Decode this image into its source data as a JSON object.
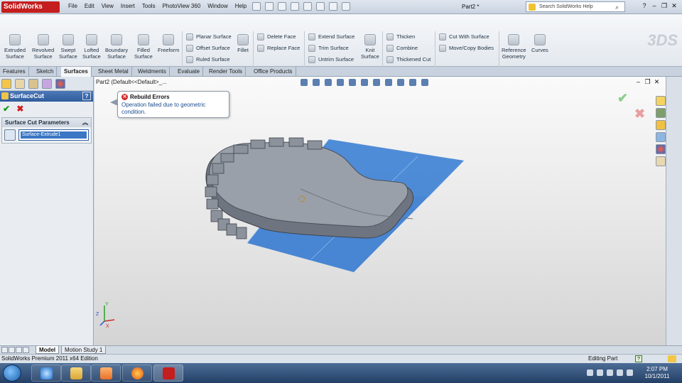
{
  "app": {
    "logo_text": "SolidWorks",
    "document_title": "Part2 *",
    "menu": [
      "File",
      "Edit",
      "View",
      "Insert",
      "Tools",
      "PhotoView 360",
      "Window",
      "Help"
    ],
    "help_search_placeholder": "Search SolidWorks Help"
  },
  "ribbon": {
    "large_tools": [
      {
        "label1": "Extruded",
        "label2": "Surface",
        "icon": "extruded-surface-icon"
      },
      {
        "label1": "Revolved",
        "label2": "Surface",
        "icon": "revolved-surface-icon"
      },
      {
        "label1": "Swept",
        "label2": "Surface",
        "icon": "swept-surface-icon"
      },
      {
        "label1": "Lofted",
        "label2": "Surface",
        "icon": "lofted-surface-icon"
      },
      {
        "label1": "Boundary",
        "label2": "Surface",
        "icon": "boundary-surface-icon"
      },
      {
        "label1": "Filled",
        "label2": "Surface",
        "icon": "filled-surface-icon"
      },
      {
        "label1": "Freeform",
        "label2": "",
        "icon": "freeform-icon"
      }
    ],
    "col1": [
      "Planar Surface",
      "Offset Surface",
      "Ruled Surface"
    ],
    "fillet": "Fillet",
    "col2": [
      "Delete Face",
      "Replace Face"
    ],
    "col3": [
      "Extend Surface",
      "Trim Surface",
      "Untrim Surface"
    ],
    "knit": {
      "label1": "Knit",
      "label2": "Surface"
    },
    "col4": [
      "Thicken",
      "Combine",
      "Thickened Cut"
    ],
    "col5": [
      "Cut With Surface",
      "Move/Copy Bodies"
    ],
    "reference": {
      "label1": "Reference",
      "label2": "Geometry"
    },
    "curves": "Curves"
  },
  "command_tabs": [
    "Features",
    "Sketch",
    "Surfaces",
    "Sheet Metal",
    "Weldments",
    "Evaluate",
    "Render Tools",
    "Office Products"
  ],
  "active_tab": "Surfaces",
  "property_manager": {
    "title": "SurfaceCut",
    "help": "?",
    "group_title": "Surface Cut Parameters",
    "selection": "Surface-Extrude1"
  },
  "graphics": {
    "tree_label": "Part2  (Default<<Default>_...",
    "tooltip_title": "Rebuild Errors",
    "tooltip_message": "Operation failed due to geometric condition."
  },
  "bottom_tabs": [
    "Model",
    "Motion Study 1"
  ],
  "status": {
    "edition": "SolidWorks Premium 2011 x64 Edition",
    "mode": "Editing Part"
  },
  "taskbar": {
    "time": "2:07 PM",
    "date": "10/1/2011",
    "pinned": [
      "internet-explorer-icon",
      "file-explorer-icon",
      "media-player-icon",
      "firefox-icon",
      "solidworks-icon"
    ]
  },
  "colors": {
    "surface_blue": "#3f7fd1",
    "part_gray": "#8a909a",
    "pm_header": "#2f5c9c",
    "error_red": "#d12a2a"
  }
}
